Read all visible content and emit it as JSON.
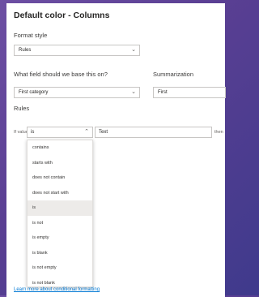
{
  "dialog": {
    "title": "Default color - Columns",
    "format_style_label": "Format style",
    "format_style_value": "Rules",
    "field_label": "What field should we base this on?",
    "field_value": "First category",
    "summarization_label": "Summarization",
    "summarization_value": "First",
    "rules_label": "Rules",
    "if_value_label": "If value",
    "condition_value": "is",
    "text_value": "Text",
    "then_label": "then",
    "dropdown_options": [
      "contains",
      "starts with",
      "does not contain",
      "does not start with",
      "is",
      "is not",
      "is empty",
      "is blank",
      "is not empty",
      "is not blank"
    ],
    "selected_option": "is",
    "learn_more_link": "Learn more about conditional formatting"
  },
  "icons": {
    "chevron_down": "chevron-down-icon",
    "chevron_up": "chevron-up-icon"
  }
}
